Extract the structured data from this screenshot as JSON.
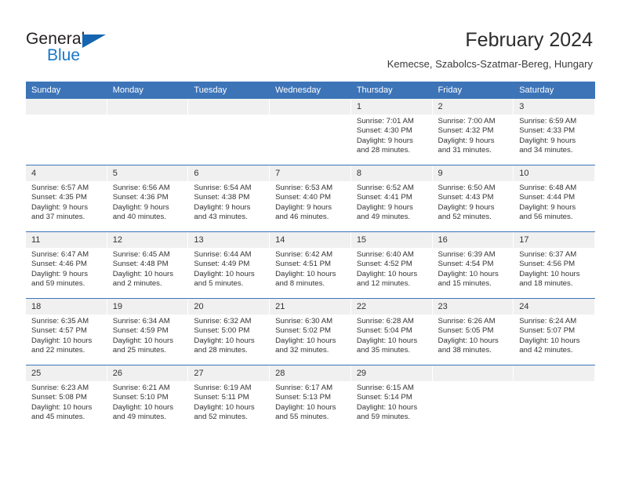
{
  "logo": {
    "word_one": "General",
    "word_two": "Blue",
    "triangle_color": "#1565b0",
    "blue_color": "#1878c8"
  },
  "header": {
    "title": "February 2024",
    "subtitle": "Kemecse, Szabolcs-Szatmar-Bereg, Hungary"
  },
  "theme": {
    "accent": "#3d74b8",
    "daynum_band": "#f0f0f0",
    "text": "#333333"
  },
  "calendar": {
    "weekday_headers": [
      "Sunday",
      "Monday",
      "Tuesday",
      "Wednesday",
      "Thursday",
      "Friday",
      "Saturday"
    ],
    "weeks": [
      [
        {
          "day": "",
          "lines": []
        },
        {
          "day": "",
          "lines": []
        },
        {
          "day": "",
          "lines": []
        },
        {
          "day": "",
          "lines": []
        },
        {
          "day": "1",
          "lines": [
            "Sunrise: 7:01 AM",
            "Sunset: 4:30 PM",
            "Daylight: 9 hours",
            "and 28 minutes."
          ]
        },
        {
          "day": "2",
          "lines": [
            "Sunrise: 7:00 AM",
            "Sunset: 4:32 PM",
            "Daylight: 9 hours",
            "and 31 minutes."
          ]
        },
        {
          "day": "3",
          "lines": [
            "Sunrise: 6:59 AM",
            "Sunset: 4:33 PM",
            "Daylight: 9 hours",
            "and 34 minutes."
          ]
        }
      ],
      [
        {
          "day": "4",
          "lines": [
            "Sunrise: 6:57 AM",
            "Sunset: 4:35 PM",
            "Daylight: 9 hours",
            "and 37 minutes."
          ]
        },
        {
          "day": "5",
          "lines": [
            "Sunrise: 6:56 AM",
            "Sunset: 4:36 PM",
            "Daylight: 9 hours",
            "and 40 minutes."
          ]
        },
        {
          "day": "6",
          "lines": [
            "Sunrise: 6:54 AM",
            "Sunset: 4:38 PM",
            "Daylight: 9 hours",
            "and 43 minutes."
          ]
        },
        {
          "day": "7",
          "lines": [
            "Sunrise: 6:53 AM",
            "Sunset: 4:40 PM",
            "Daylight: 9 hours",
            "and 46 minutes."
          ]
        },
        {
          "day": "8",
          "lines": [
            "Sunrise: 6:52 AM",
            "Sunset: 4:41 PM",
            "Daylight: 9 hours",
            "and 49 minutes."
          ]
        },
        {
          "day": "9",
          "lines": [
            "Sunrise: 6:50 AM",
            "Sunset: 4:43 PM",
            "Daylight: 9 hours",
            "and 52 minutes."
          ]
        },
        {
          "day": "10",
          "lines": [
            "Sunrise: 6:48 AM",
            "Sunset: 4:44 PM",
            "Daylight: 9 hours",
            "and 56 minutes."
          ]
        }
      ],
      [
        {
          "day": "11",
          "lines": [
            "Sunrise: 6:47 AM",
            "Sunset: 4:46 PM",
            "Daylight: 9 hours",
            "and 59 minutes."
          ]
        },
        {
          "day": "12",
          "lines": [
            "Sunrise: 6:45 AM",
            "Sunset: 4:48 PM",
            "Daylight: 10 hours",
            "and 2 minutes."
          ]
        },
        {
          "day": "13",
          "lines": [
            "Sunrise: 6:44 AM",
            "Sunset: 4:49 PM",
            "Daylight: 10 hours",
            "and 5 minutes."
          ]
        },
        {
          "day": "14",
          "lines": [
            "Sunrise: 6:42 AM",
            "Sunset: 4:51 PM",
            "Daylight: 10 hours",
            "and 8 minutes."
          ]
        },
        {
          "day": "15",
          "lines": [
            "Sunrise: 6:40 AM",
            "Sunset: 4:52 PM",
            "Daylight: 10 hours",
            "and 12 minutes."
          ]
        },
        {
          "day": "16",
          "lines": [
            "Sunrise: 6:39 AM",
            "Sunset: 4:54 PM",
            "Daylight: 10 hours",
            "and 15 minutes."
          ]
        },
        {
          "day": "17",
          "lines": [
            "Sunrise: 6:37 AM",
            "Sunset: 4:56 PM",
            "Daylight: 10 hours",
            "and 18 minutes."
          ]
        }
      ],
      [
        {
          "day": "18",
          "lines": [
            "Sunrise: 6:35 AM",
            "Sunset: 4:57 PM",
            "Daylight: 10 hours",
            "and 22 minutes."
          ]
        },
        {
          "day": "19",
          "lines": [
            "Sunrise: 6:34 AM",
            "Sunset: 4:59 PM",
            "Daylight: 10 hours",
            "and 25 minutes."
          ]
        },
        {
          "day": "20",
          "lines": [
            "Sunrise: 6:32 AM",
            "Sunset: 5:00 PM",
            "Daylight: 10 hours",
            "and 28 minutes."
          ]
        },
        {
          "day": "21",
          "lines": [
            "Sunrise: 6:30 AM",
            "Sunset: 5:02 PM",
            "Daylight: 10 hours",
            "and 32 minutes."
          ]
        },
        {
          "day": "22",
          "lines": [
            "Sunrise: 6:28 AM",
            "Sunset: 5:04 PM",
            "Daylight: 10 hours",
            "and 35 minutes."
          ]
        },
        {
          "day": "23",
          "lines": [
            "Sunrise: 6:26 AM",
            "Sunset: 5:05 PM",
            "Daylight: 10 hours",
            "and 38 minutes."
          ]
        },
        {
          "day": "24",
          "lines": [
            "Sunrise: 6:24 AM",
            "Sunset: 5:07 PM",
            "Daylight: 10 hours",
            "and 42 minutes."
          ]
        }
      ],
      [
        {
          "day": "25",
          "lines": [
            "Sunrise: 6:23 AM",
            "Sunset: 5:08 PM",
            "Daylight: 10 hours",
            "and 45 minutes."
          ]
        },
        {
          "day": "26",
          "lines": [
            "Sunrise: 6:21 AM",
            "Sunset: 5:10 PM",
            "Daylight: 10 hours",
            "and 49 minutes."
          ]
        },
        {
          "day": "27",
          "lines": [
            "Sunrise: 6:19 AM",
            "Sunset: 5:11 PM",
            "Daylight: 10 hours",
            "and 52 minutes."
          ]
        },
        {
          "day": "28",
          "lines": [
            "Sunrise: 6:17 AM",
            "Sunset: 5:13 PM",
            "Daylight: 10 hours",
            "and 55 minutes."
          ]
        },
        {
          "day": "29",
          "lines": [
            "Sunrise: 6:15 AM",
            "Sunset: 5:14 PM",
            "Daylight: 10 hours",
            "and 59 minutes."
          ]
        },
        {
          "day": "",
          "lines": []
        },
        {
          "day": "",
          "lines": []
        }
      ]
    ]
  }
}
